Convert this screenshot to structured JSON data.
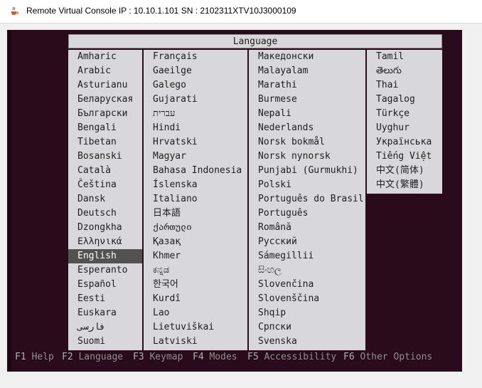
{
  "window": {
    "title": "Remote Virtual Console    IP : 10.10.1.101    SN : 2102311XTV10J3000109"
  },
  "dialog": {
    "title": "Language",
    "columns": [
      [
        "Amharic",
        "Arabic",
        "Asturianu",
        "Беларуская",
        "Български",
        "Bengali",
        "Tibetan",
        "Bosanski",
        "Català",
        "Čeština",
        "Dansk",
        "Deutsch",
        "Dzongkha",
        "Ελληνικά",
        "English",
        "Esperanto",
        "Español",
        "Eesti",
        "Euskara",
        "فارسی",
        "Suomi"
      ],
      [
        "Français",
        "Gaeilge",
        "Galego",
        "Gujarati",
        "עברית",
        "Hindi",
        "Hrvatski",
        "Magyar",
        "Bahasa Indonesia",
        "Íslenska",
        "Italiano",
        "日本語",
        "ქართული",
        "Қазақ",
        "Khmer",
        "ಕನ್ನಡ",
        "한국어",
        "Kurdî",
        "Lao",
        "Lietuviškai",
        "Latviski"
      ],
      [
        "Македонски",
        "Malayalam",
        "Marathi",
        "Burmese",
        "Nepali",
        "Nederlands",
        "Norsk bokmål",
        "Norsk nynorsk",
        "Punjabi (Gurmukhi)",
        "Polski",
        "Português do Brasil",
        "Português",
        "Română",
        "Русский",
        "Sámegillii",
        "සිංහල",
        "Slovenčina",
        "Slovenščina",
        "Shqip",
        "Српски",
        "Svenska"
      ],
      [
        "Tamil",
        "తెలుగు",
        "Thai",
        "Tagalog",
        "Türkçe",
        "Uyghur",
        "Українська",
        "Tiếng Việt",
        "中文(简体)",
        "中文(繁體)"
      ]
    ],
    "selected": "English"
  },
  "helpbar": {
    "items": [
      {
        "key": "F1",
        "label": "Help"
      },
      {
        "key": "F2",
        "label": "Language"
      },
      {
        "key": "F3",
        "label": "Keymap"
      },
      {
        "key": "F4",
        "label": "Modes"
      },
      {
        "key": "F5",
        "label": "Accessibility"
      },
      {
        "key": "F6",
        "label": "Other Options"
      }
    ]
  },
  "colors": {
    "console_bg": "#2a0b1c",
    "menu_bg": "#d8d8dc",
    "selected_bg": "#525252",
    "help_text": "#8e8e8e"
  }
}
